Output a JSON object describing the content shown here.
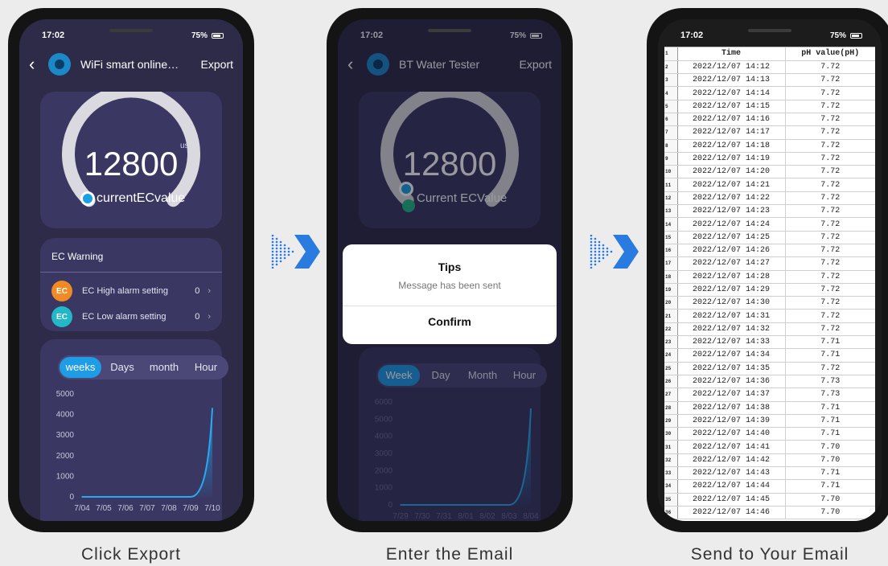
{
  "phone1": {
    "status": {
      "time": "17:02",
      "battery": "75%"
    },
    "header": {
      "title": "WiFi smart  online…",
      "export_label": "Export"
    },
    "gauge": {
      "value": "12800",
      "unit": "us",
      "label": "currentECvalue",
      "fill_fraction": 0.85
    },
    "warning": {
      "title": "EC Warning",
      "high": {
        "badge": "EC",
        "label": "EC High alarm setting",
        "value": "0"
      },
      "low": {
        "badge": "EC",
        "label": "EC Low alarm setting",
        "value": "0"
      }
    },
    "tabs": [
      "weeks",
      "Days",
      "month",
      "Hour"
    ]
  },
  "phone2": {
    "status": {
      "time": "17:02",
      "battery": "75%"
    },
    "header": {
      "title": "BT Water Tester",
      "export_label": "Export"
    },
    "gauge": {
      "value": "12800",
      "label": "Current  ECValue"
    },
    "dialog": {
      "title": "Tips",
      "message": "Message has been sent",
      "confirm_label": "Confirm"
    },
    "tabs": [
      "Week",
      "Day",
      "Month",
      "Hour"
    ]
  },
  "phone3": {
    "status": {
      "time": "17:02",
      "battery": "75%"
    },
    "headers": [
      "Time",
      "pH value(pH)"
    ],
    "rows": [
      [
        "2022/12/07 14:12",
        "7.72"
      ],
      [
        "2022/12/07 14:13",
        "7.72"
      ],
      [
        "2022/12/07 14:14",
        "7.72"
      ],
      [
        "2022/12/07 14:15",
        "7.72"
      ],
      [
        "2022/12/07 14:16",
        "7.72"
      ],
      [
        "2022/12/07 14:17",
        "7.72"
      ],
      [
        "2022/12/07 14:18",
        "7.72"
      ],
      [
        "2022/12/07 14:19",
        "7.72"
      ],
      [
        "2022/12/07 14:20",
        "7.72"
      ],
      [
        "2022/12/07 14:21",
        "7.72"
      ],
      [
        "2022/12/07 14:22",
        "7.72"
      ],
      [
        "2022/12/07 14:23",
        "7.72"
      ],
      [
        "2022/12/07 14:24",
        "7.72"
      ],
      [
        "2022/12/07 14:25",
        "7.72"
      ],
      [
        "2022/12/07 14:26",
        "7.72"
      ],
      [
        "2022/12/07 14:27",
        "7.72"
      ],
      [
        "2022/12/07 14:28",
        "7.72"
      ],
      [
        "2022/12/07 14:29",
        "7.72"
      ],
      [
        "2022/12/07 14:30",
        "7.72"
      ],
      [
        "2022/12/07 14:31",
        "7.72"
      ],
      [
        "2022/12/07 14:32",
        "7.72"
      ],
      [
        "2022/12/07 14:33",
        "7.71"
      ],
      [
        "2022/12/07 14:34",
        "7.71"
      ],
      [
        "2022/12/07 14:35",
        "7.72"
      ],
      [
        "2022/12/07 14:36",
        "7.73"
      ],
      [
        "2022/12/07 14:37",
        "7.73"
      ],
      [
        "2022/12/07 14:38",
        "7.71"
      ],
      [
        "2022/12/07 14:39",
        "7.71"
      ],
      [
        "2022/12/07 14:40",
        "7.71"
      ],
      [
        "2022/12/07 14:41",
        "7.70"
      ],
      [
        "2022/12/07 14:42",
        "7.70"
      ],
      [
        "2022/12/07 14:43",
        "7.71"
      ],
      [
        "2022/12/07 14:44",
        "7.71"
      ],
      [
        "2022/12/07 14:45",
        "7.70"
      ],
      [
        "2022/12/07 14:46",
        "7.70"
      ]
    ]
  },
  "captions": [
    "Click Export",
    "Enter the Email",
    "Send to Your Email"
  ],
  "colors": {
    "accent": "#1f9ce6",
    "card": "#3a3762",
    "screen": "#2d2b48",
    "high_badge": "#f08a24",
    "low_badge": "#22b8c8"
  },
  "chart_data": [
    {
      "type": "area",
      "x": [
        "7/04",
        "7/05",
        "7/06",
        "7/07",
        "7/08",
        "7/09",
        "7/10"
      ],
      "y": [
        0,
        0,
        0,
        0,
        0,
        0,
        4300
      ],
      "yticks": [
        0,
        1000,
        2000,
        3000,
        4000,
        5000
      ],
      "ylim": [
        0,
        5000
      ],
      "title": "",
      "xlabel": "",
      "ylabel": ""
    },
    {
      "type": "area",
      "x": [
        "7/29",
        "7/30",
        "7/31",
        "8/01",
        "8/02",
        "8/03",
        "8/04"
      ],
      "y": [
        0,
        0,
        0,
        0,
        0,
        0,
        5600
      ],
      "yticks": [
        0,
        1000,
        2000,
        3000,
        4000,
        5000,
        6000
      ],
      "ylim": [
        0,
        6000
      ],
      "title": "",
      "xlabel": "",
      "ylabel": ""
    }
  ]
}
